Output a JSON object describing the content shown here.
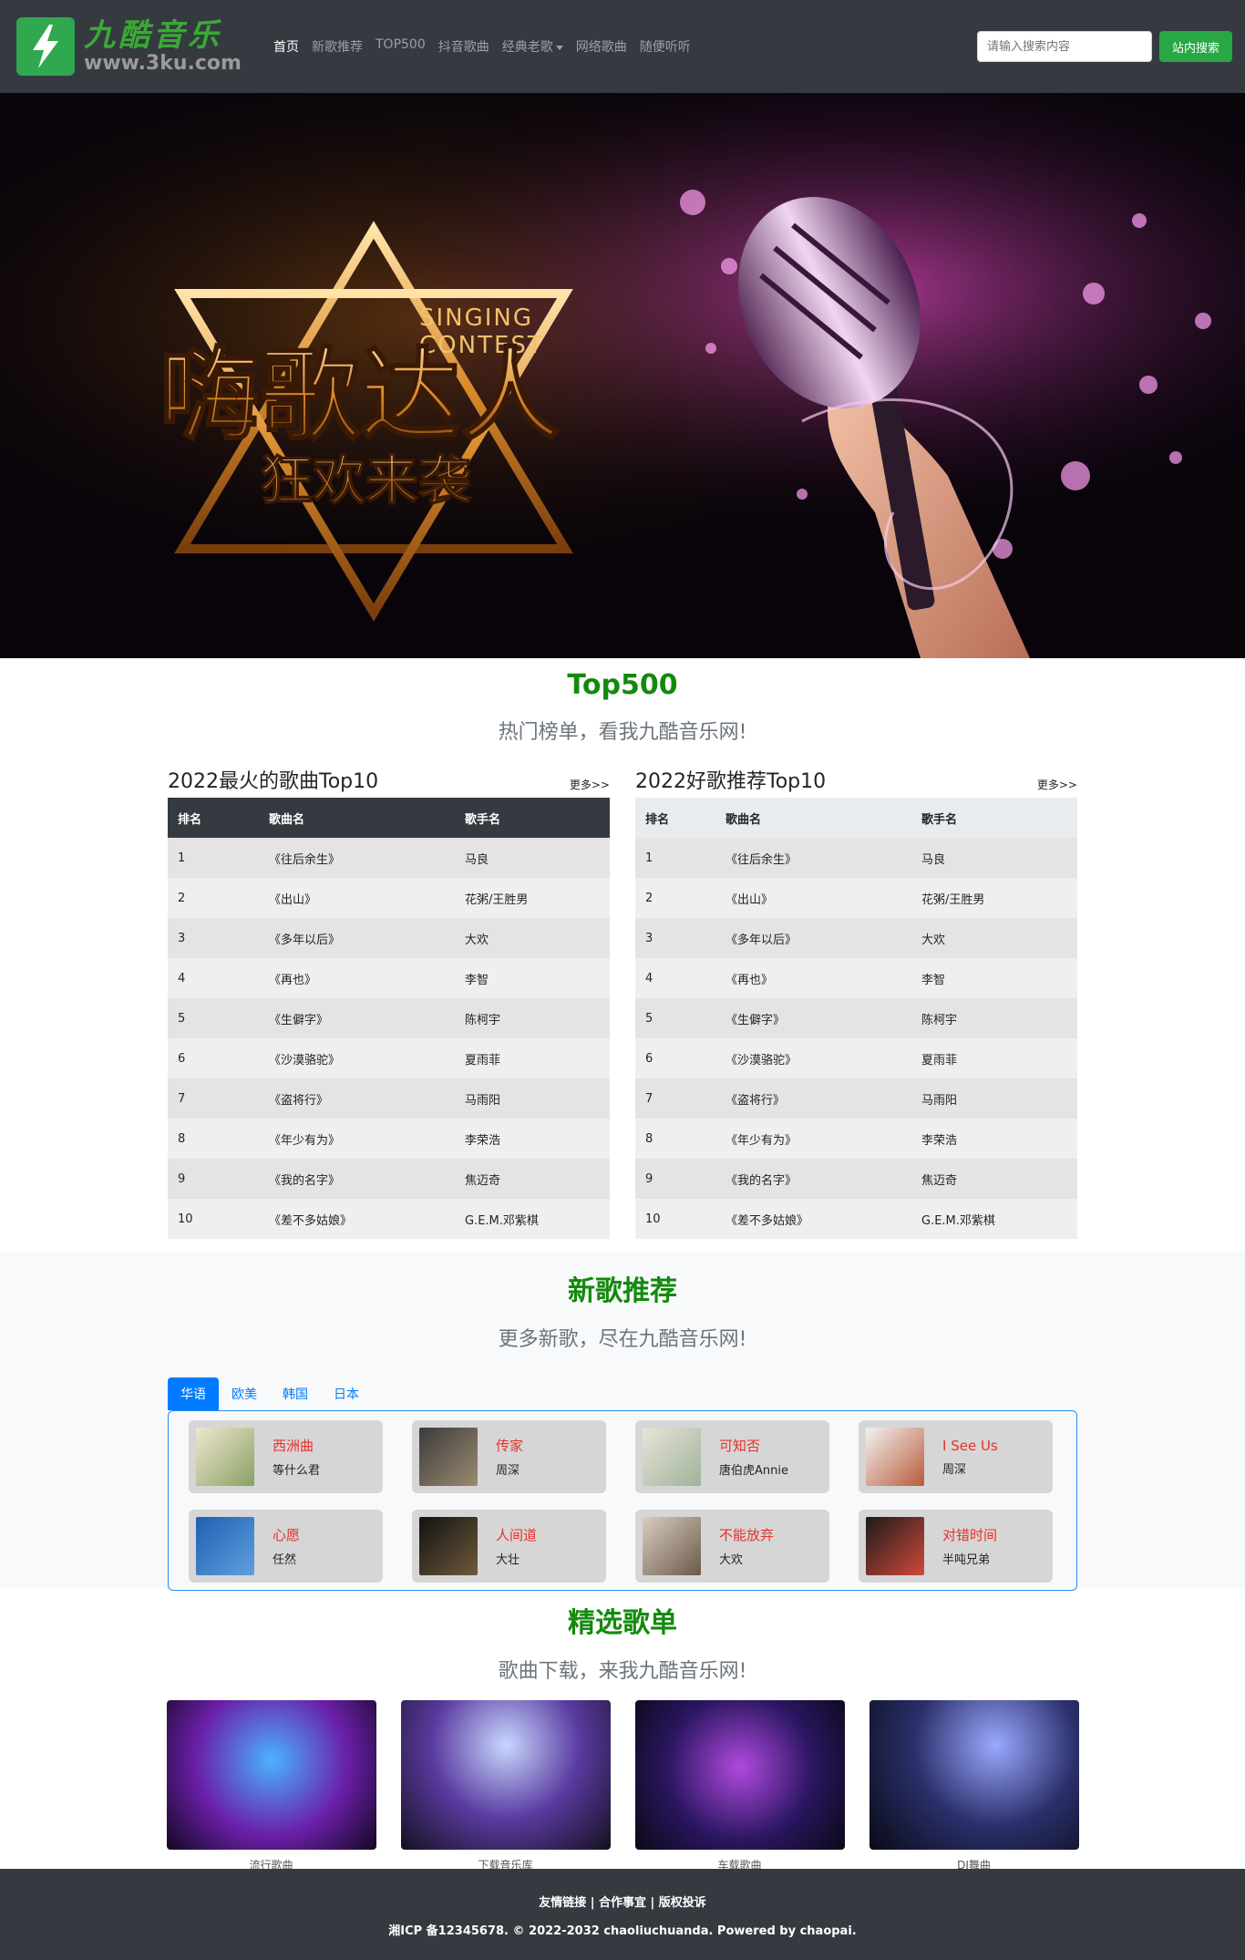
{
  "header": {
    "logo_cn": "九酷音乐",
    "logo_url": "www.3ku.com",
    "nav": [
      {
        "label": "首页"
      },
      {
        "label": "新歌推荐"
      },
      {
        "label": "TOP500"
      },
      {
        "label": "抖音歌曲"
      },
      {
        "label": "经典老歌"
      },
      {
        "label": "网络歌曲"
      },
      {
        "label": "随便听听"
      }
    ],
    "search_placeholder": "请输入搜索内容",
    "search_button": "站内搜索"
  },
  "banner": {
    "headline": "嗨歌达人",
    "subline": "狂欢来袭",
    "english_1": "SINGING",
    "english_2": "CONTEST"
  },
  "top500": {
    "title": "Top500",
    "subtitle": "热门榜单，看我九酷音乐网!",
    "more": "更多>>",
    "columns": [
      "排名",
      "歌曲名",
      "歌手名"
    ],
    "table_left_title": "2022最火的歌曲Top10",
    "table_right_title": "2022好歌推荐Top10",
    "rows": [
      [
        "1",
        "《往后余生》",
        "马良"
      ],
      [
        "2",
        "《出山》",
        "花粥/王胜男"
      ],
      [
        "3",
        "《多年以后》",
        "大欢"
      ],
      [
        "4",
        "《再也》",
        "李智"
      ],
      [
        "5",
        "《生僻字》",
        "陈柯宇"
      ],
      [
        "6",
        "《沙漠骆驼》",
        "夏雨菲"
      ],
      [
        "7",
        "《盗将行》",
        "马雨阳"
      ],
      [
        "8",
        "《年少有为》",
        "李荣浩"
      ],
      [
        "9",
        "《我的名字》",
        "焦迈奇"
      ],
      [
        "10",
        "《差不多姑娘》",
        "G.E.M.邓紫棋"
      ]
    ]
  },
  "newsongs": {
    "title": "新歌推荐",
    "subtitle": "更多新歌，尽在九酷音乐网!",
    "tabs": [
      "华语",
      "欧美",
      "韩国",
      "日本"
    ],
    "songs": [
      {
        "name": "西洲曲",
        "artist": "等什么君"
      },
      {
        "name": "传家",
        "artist": "周深"
      },
      {
        "name": "可知否",
        "artist": "唐伯虎Annie"
      },
      {
        "name": "I See Us",
        "artist": "周深"
      },
      {
        "name": "心愿",
        "artist": "任然"
      },
      {
        "name": "人间道",
        "artist": "大壮"
      },
      {
        "name": "不能放弃",
        "artist": "大欢"
      },
      {
        "name": "对错时间",
        "artist": "半吨兄弟"
      }
    ]
  },
  "playlists": {
    "title": "精选歌单",
    "subtitle": "歌曲下载，来我九酷音乐网!",
    "items": [
      "流行歌曲",
      "下载音乐库",
      "车载歌曲",
      "DJ舞曲"
    ]
  },
  "footer": {
    "links": "友情链接 | 合作事宜 | 版权投诉",
    "copyright": "湘ICP 备12345678. © 2022-2032 chaoliuchuanda. Powered by chaopai."
  },
  "colors": {
    "navbar": "#343a40",
    "accent_green": "#138a0e",
    "search_button": "#28a745",
    "tab_blue": "#007bff",
    "song_name_red": "#e8302a"
  }
}
